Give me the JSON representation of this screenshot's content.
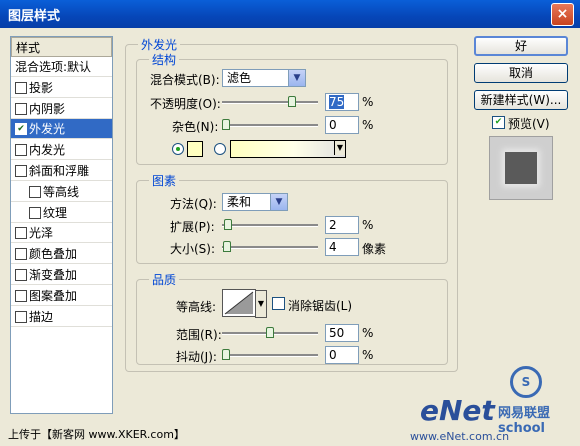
{
  "window": {
    "title": "图层样式",
    "close_glyph": "×"
  },
  "left_panel": {
    "header": "样式",
    "items": [
      {
        "label": "混合选项:默认",
        "checkbox": false,
        "checked": false,
        "indent": 0
      },
      {
        "label": "投影",
        "checkbox": true,
        "checked": false,
        "indent": 0
      },
      {
        "label": "内阴影",
        "checkbox": true,
        "checked": false,
        "indent": 0
      },
      {
        "label": "外发光",
        "checkbox": true,
        "checked": true,
        "indent": 0,
        "selected": true
      },
      {
        "label": "内发光",
        "checkbox": true,
        "checked": false,
        "indent": 0
      },
      {
        "label": "斜面和浮雕",
        "checkbox": true,
        "checked": false,
        "indent": 0
      },
      {
        "label": "等高线",
        "checkbox": true,
        "checked": false,
        "indent": 1
      },
      {
        "label": "纹理",
        "checkbox": true,
        "checked": false,
        "indent": 1
      },
      {
        "label": "光泽",
        "checkbox": true,
        "checked": false,
        "indent": 0
      },
      {
        "label": "颜色叠加",
        "checkbox": true,
        "checked": false,
        "indent": 0
      },
      {
        "label": "渐变叠加",
        "checkbox": true,
        "checked": false,
        "indent": 0
      },
      {
        "label": "图案叠加",
        "checkbox": true,
        "checked": false,
        "indent": 0
      },
      {
        "label": "描边",
        "checkbox": true,
        "checked": false,
        "indent": 0
      }
    ]
  },
  "outer_glow": {
    "title": "外发光",
    "structure": {
      "title": "结构",
      "blend_mode_label": "混合模式(B):",
      "blend_mode_value": "滤色",
      "opacity_label": "不透明度(O):",
      "opacity_value": "75",
      "opacity_fraction": 0.75,
      "noise_label": "杂色(N):",
      "noise_value": "0",
      "noise_fraction": 0,
      "percent": "%"
    },
    "elements": {
      "title": "图素",
      "method_label": "方法(Q):",
      "method_value": "柔和",
      "spread_label": "扩展(P):",
      "spread_value": "2",
      "spread_fraction": 0.02,
      "size_label": "大小(S):",
      "size_value": "4",
      "size_fraction": 0.016,
      "percent": "%",
      "px": "像素"
    },
    "quality": {
      "title": "品质",
      "contour_label": "等高线:",
      "antialias_label": "消除锯齿(L)",
      "range_label": "范围(R):",
      "range_value": "50",
      "range_fraction": 0.5,
      "jitter_label": "抖动(J):",
      "jitter_value": "0",
      "jitter_fraction": 0,
      "percent": "%"
    }
  },
  "buttons": {
    "ok": "好",
    "cancel": "取消",
    "new_style": "新建样式(W)...",
    "preview": "预览(V)"
  },
  "footer": {
    "uploaded": "上传于【新客网 www.XKER.com】",
    "watermark_brand": "eNet",
    "watermark_url": "www.eNet.com.cn",
    "watermark_school": "网易联盟 school"
  }
}
